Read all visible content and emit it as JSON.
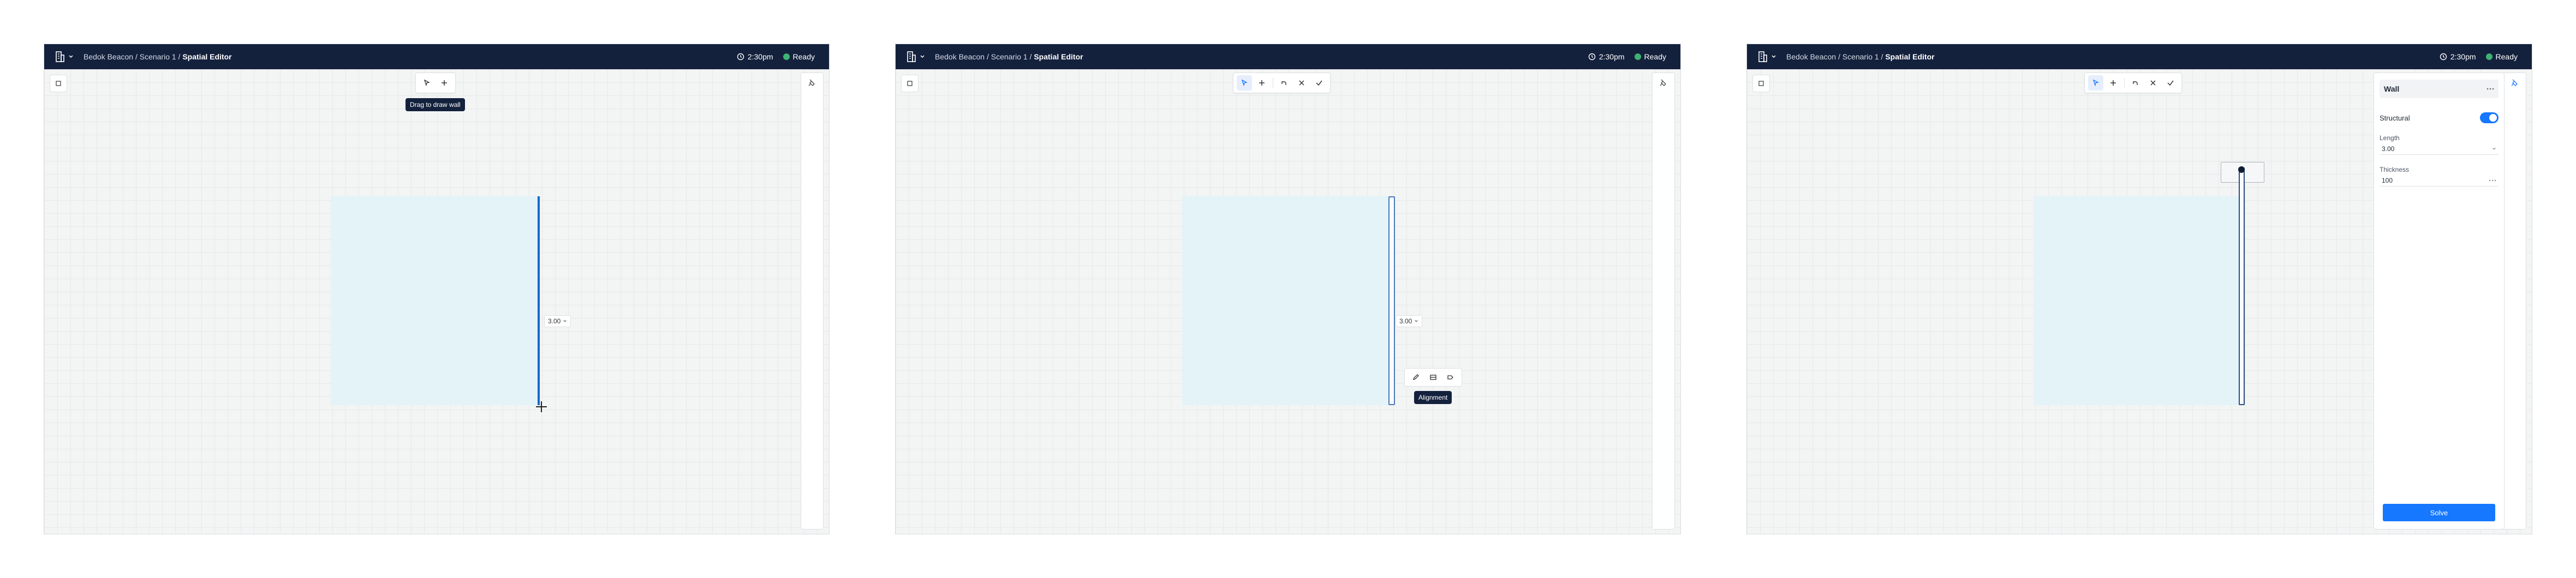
{
  "header": {
    "breadcrumb_prefix": "Bedok Beacon / Scenario 1 / ",
    "breadcrumb_current": "Spatial Editor",
    "time": "2:30pm",
    "status": "Ready"
  },
  "panel1": {
    "tooltip": "Drag to draw wall",
    "dimension": "3.00"
  },
  "panel2": {
    "dimension": "3.00",
    "tooltip": "Alignment"
  },
  "panel3": {
    "title": "Wall",
    "structural_label": "Structural",
    "structural_on": true,
    "length_label": "Length",
    "length_value": "3.00",
    "thickness_label": "Thickness",
    "thickness_value": "100",
    "apply_label": "Solve"
  },
  "colors": {
    "topbar": "#14213d",
    "accent": "#1677ff",
    "wall": "#1668c7",
    "room": "#e4f3f8",
    "ready": "#3cb371"
  }
}
